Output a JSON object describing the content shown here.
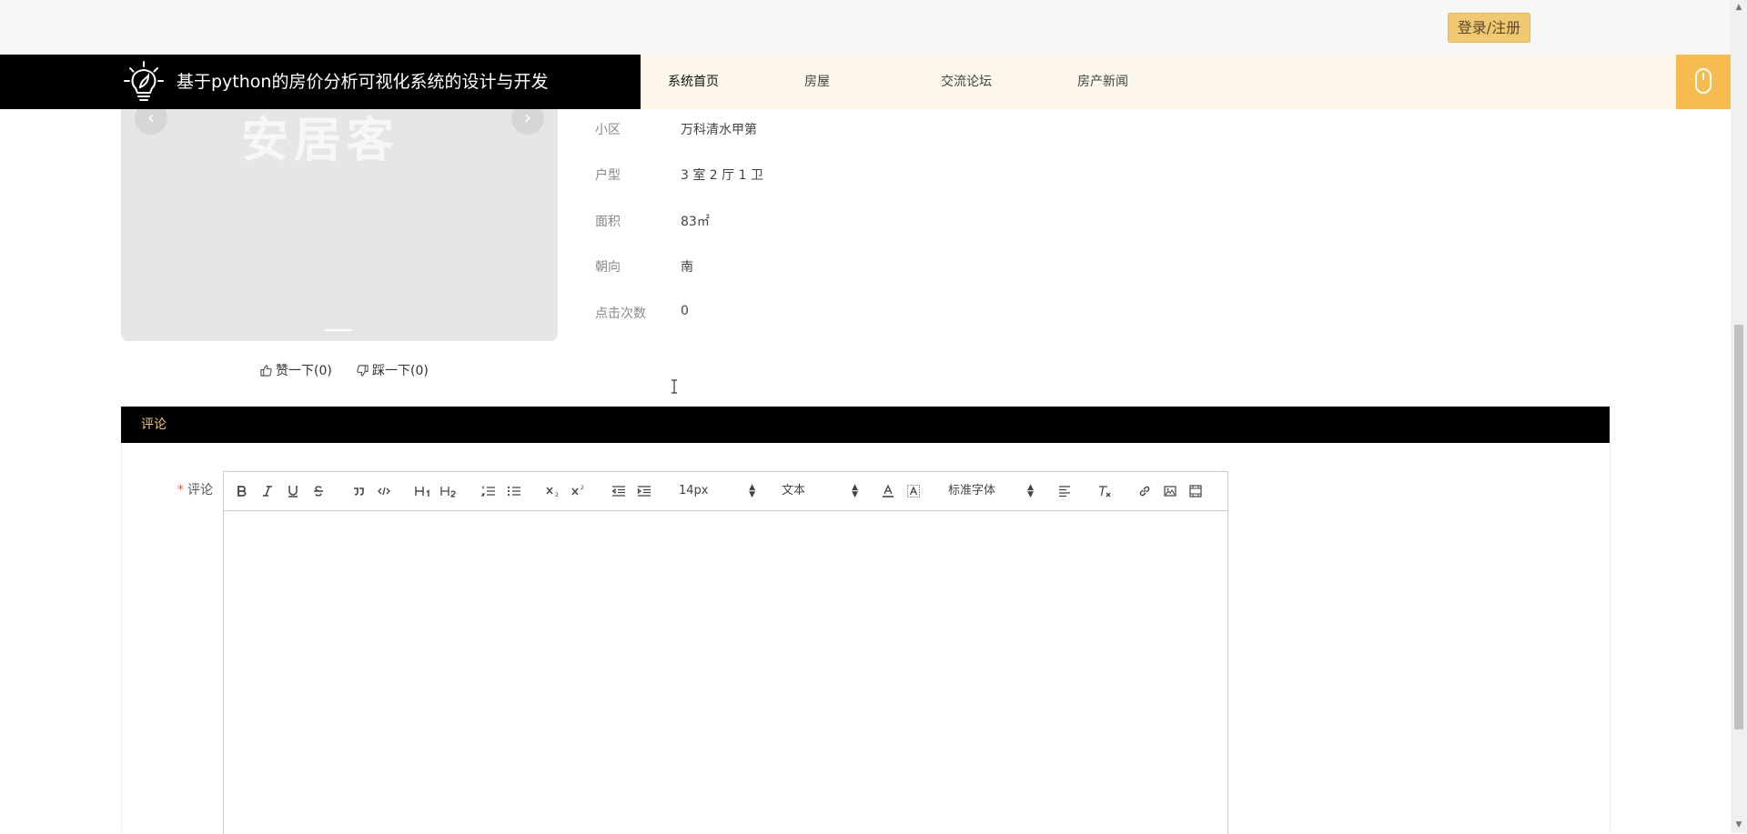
{
  "topbar": {
    "login_label": "登录/注册"
  },
  "header": {
    "title": "基于python的房价分析可视化系统的设计与开发",
    "nav": [
      {
        "label": "系统首页"
      },
      {
        "label": "房屋"
      },
      {
        "label": "交流论坛"
      },
      {
        "label": "房产新闻"
      }
    ],
    "accent_color": "#f7bb50"
  },
  "carousel": {
    "watermark": "安居客"
  },
  "house_info": {
    "rows": [
      {
        "label": "小区",
        "value": "万科清水甲第"
      },
      {
        "label": "户型",
        "value": "3 室 2 厅 1 卫"
      },
      {
        "label": "面积",
        "value": "83㎡"
      },
      {
        "label": "朝向",
        "value": "南"
      },
      {
        "label": "点击次数",
        "value": "0"
      }
    ]
  },
  "votes": {
    "like_label": "赞一下(0)",
    "dislike_label": "踩一下(0)"
  },
  "comment": {
    "section_title": "评论",
    "field_label": "评论",
    "required_mark": "*",
    "editor": {
      "font_size": "14px",
      "text_type": "文本",
      "font_family": "标准字体"
    }
  }
}
